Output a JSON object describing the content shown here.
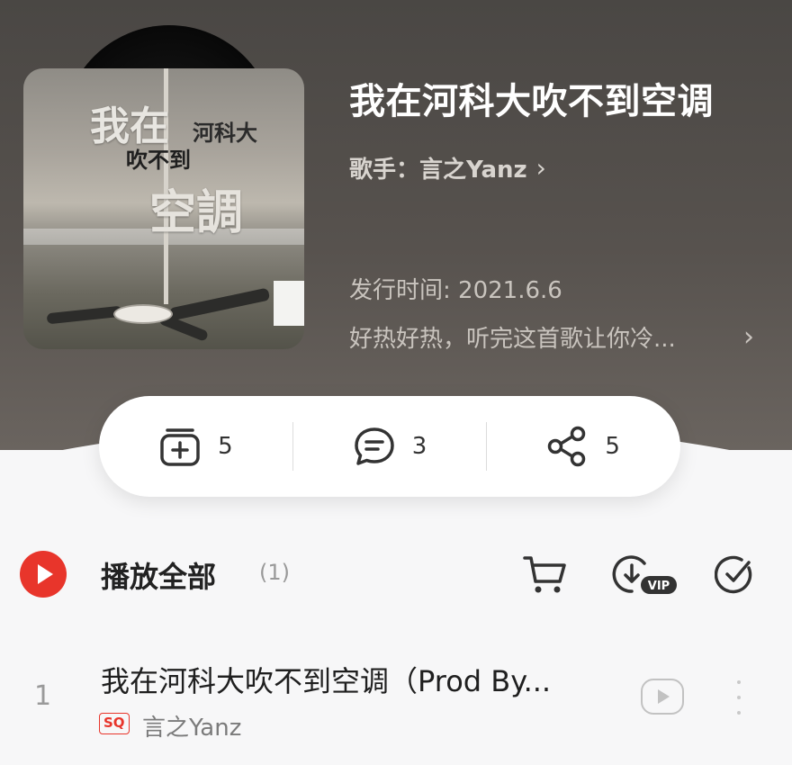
{
  "album": {
    "cover_text": [
      "我在",
      "河科大",
      "吹不到",
      "空調"
    ],
    "title": "我在河科大吹不到空调",
    "singer_label": "歌手：言之Yanz",
    "release_label": "发行时间: 2021.6.6",
    "description": "好热好热，听完这首歌让你冷..."
  },
  "actions": [
    {
      "name": "collect",
      "count": "5"
    },
    {
      "name": "comment",
      "count": "3"
    },
    {
      "name": "share",
      "count": "5"
    }
  ],
  "playbar": {
    "label": "播放全部",
    "count": "(1)"
  },
  "tracks": [
    {
      "number": "1",
      "title": "我在河科大吹不到空调（Prod By...",
      "quality_badge": "SQ",
      "artist": "言之Yanz"
    }
  ],
  "colors": {
    "accent": "#e8352b",
    "header_bg": "#4f4b47"
  }
}
